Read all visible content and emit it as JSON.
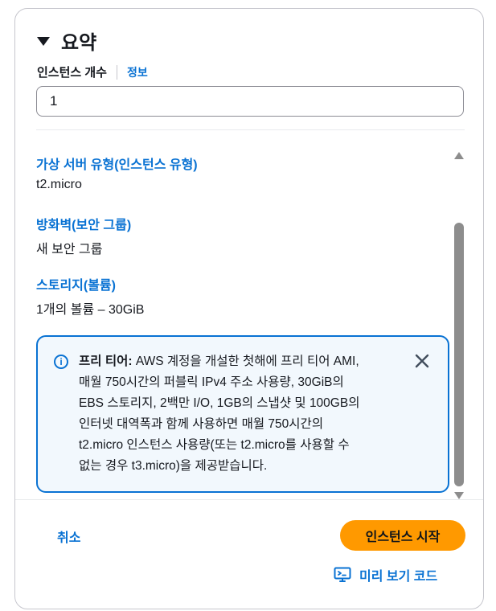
{
  "summary": {
    "title": "요약"
  },
  "instance_count": {
    "label": "인스턴스 개수",
    "info_link": "정보",
    "value": "1"
  },
  "fields": [
    {
      "label": "가상 서버 유형(인스턴스 유형)",
      "value": "t2.micro"
    },
    {
      "label": "방화벽(보안 그룹)",
      "value": "새 보안 그룹"
    },
    {
      "label": "스토리지(볼륨)",
      "value": "1개의 볼륨 – 30GiB"
    }
  ],
  "alert": {
    "title": "프리 티어:",
    "line1": "AWS 계정을 개설한 첫해에 프리 티어 AMI,",
    "line2": "매월 750시간의 퍼블릭 IPv4 주소 사용량, 30GiB의",
    "line3": "EBS 스토리지, 2백만 I/O, 1GB의 스냅샷 및 100GB의",
    "line4": "인터넷 대역폭과 함께 사용하면 매월 750시간의",
    "line5": "t2.micro 인스턴스 사용량(또는 t2.micro를 사용할 수",
    "line6": "없는 경우 t3.micro)을 제공받습니다."
  },
  "footer": {
    "cancel_label": "취소",
    "launch_label": "인스턴스 시작",
    "preview_label": "미리 보기 코드"
  },
  "colors": {
    "accent": "#0972d3",
    "primary_button": "#ff9900",
    "alert_background": "#f2f8fd"
  },
  "icons": {
    "collapse": "caret-down-icon",
    "info": "info-icon",
    "close": "close-icon",
    "preview": "code-preview-icon"
  }
}
